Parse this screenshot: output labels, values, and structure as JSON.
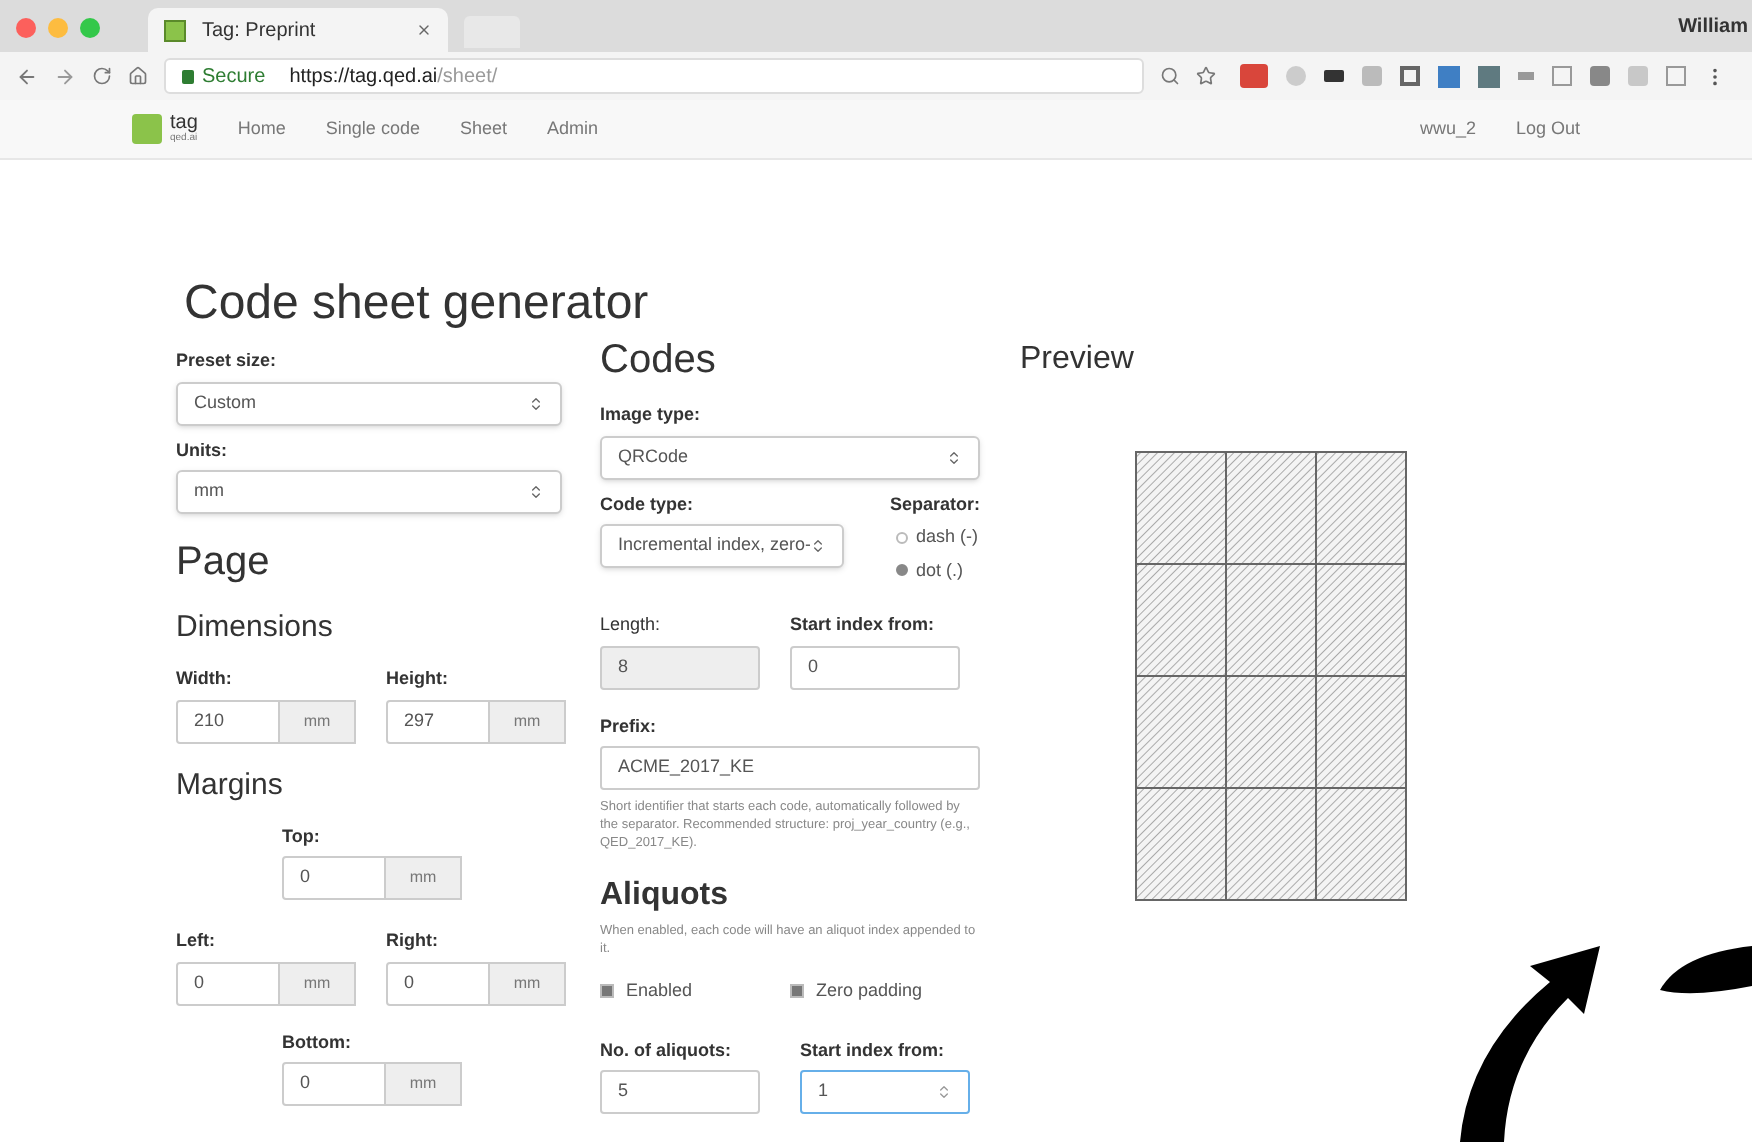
{
  "browser": {
    "tab_title": "Tag: Preprint",
    "profile": "William",
    "secure_label": "Secure",
    "url_host": "https://tag.qed.ai",
    "url_path": "/sheet/"
  },
  "navbar": {
    "logo_text": "tag",
    "logo_sub": "qed.ai",
    "links": [
      {
        "label": "Home"
      },
      {
        "label": "Single code"
      },
      {
        "label": "Sheet"
      },
      {
        "label": "Admin"
      }
    ],
    "user": "wwu_2",
    "logout": "Log Out"
  },
  "title": "Code sheet generator",
  "settings": {
    "preset": {
      "label": "Preset size:",
      "value": "Custom"
    },
    "units": {
      "label": "Units:",
      "value": "mm"
    }
  },
  "page": {
    "heading": "Page",
    "dimensions_heading": "Dimensions",
    "width": {
      "label": "Width:",
      "value": "210",
      "unit": "mm"
    },
    "height": {
      "label": "Height:",
      "value": "297",
      "unit": "mm"
    },
    "margins_heading": "Margins",
    "top": {
      "label": "Top:",
      "value": "0",
      "unit": "mm"
    },
    "left": {
      "label": "Left:",
      "value": "0",
      "unit": "mm"
    },
    "right": {
      "label": "Right:",
      "value": "0",
      "unit": "mm"
    },
    "bottom": {
      "label": "Bottom:",
      "value": "0",
      "unit": "mm"
    }
  },
  "codes": {
    "heading": "Codes",
    "image_type": {
      "label": "Image type:",
      "value": "QRCode"
    },
    "code_type": {
      "label": "Code type:",
      "value": "Incremental index, zero-"
    },
    "separator": {
      "label": "Separator:",
      "options": [
        {
          "label": "dash (-)",
          "selected": false
        },
        {
          "label": "dot (.)",
          "selected": true
        }
      ]
    },
    "length": {
      "label": "Length:",
      "value": "8",
      "disabled": true
    },
    "start_index": {
      "label": "Start index from:",
      "value": "0"
    },
    "prefix": {
      "label": "Prefix:",
      "value": "ACME_2017_KE",
      "help": "Short identifier that starts each code, automatically followed by the separator. Recommended structure: proj_year_country (e.g., QED_2017_KE)."
    }
  },
  "aliquots": {
    "heading": "Aliquots",
    "help": "When enabled, each code will have an aliquot index appended to it.",
    "checkboxes": [
      {
        "label": "Enabled",
        "checked": true
      },
      {
        "label": "Zero padding",
        "checked": true
      }
    ],
    "count": {
      "label": "No. of aliquots:",
      "value": "5"
    },
    "start_index": {
      "label": "Start index from:",
      "value": "1"
    }
  },
  "preview": {
    "heading": "Preview"
  }
}
